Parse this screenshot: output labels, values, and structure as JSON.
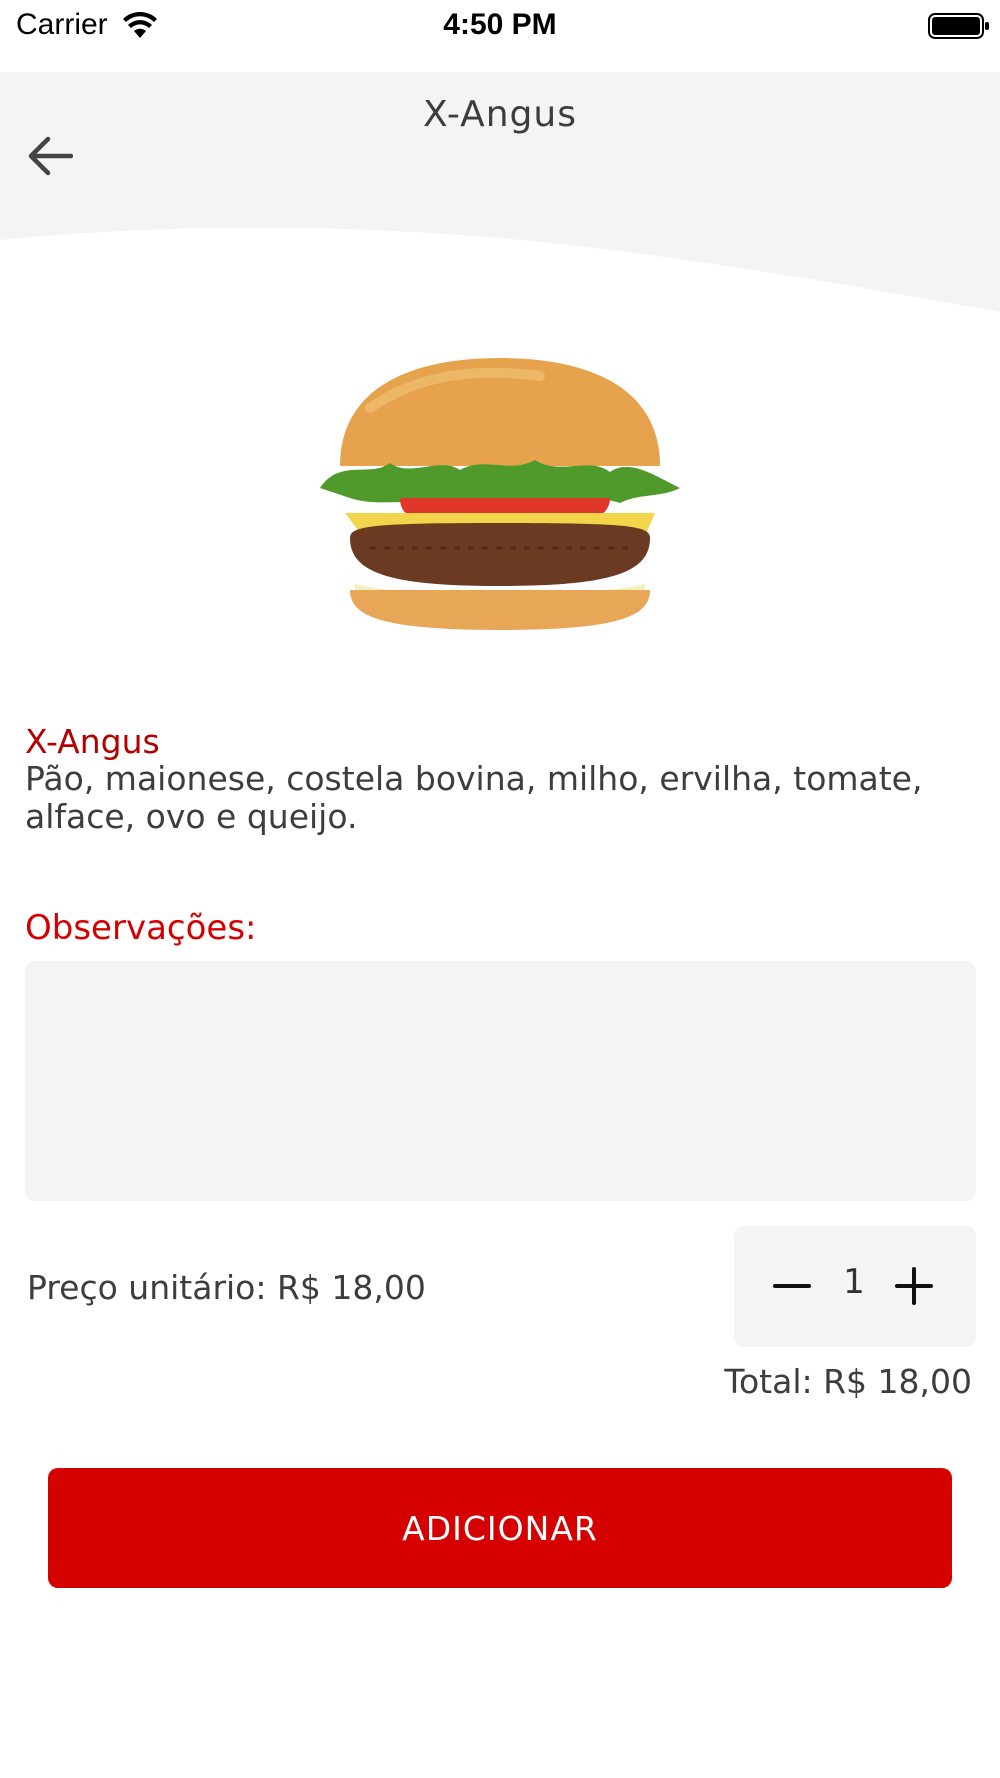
{
  "status_bar": {
    "carrier": "Carrier",
    "time": "4:50 PM",
    "icons": [
      "wifi-icon",
      "battery-icon"
    ]
  },
  "header": {
    "title": "X-Angus",
    "back_icon": "arrow-left-icon"
  },
  "product": {
    "name": "X-Angus",
    "description": "Pão, maionese, costela bovina, milho, ervilha, tomate, alface, ovo e queijo.",
    "image": "hamburger-photo"
  },
  "observations": {
    "label": "Observações:",
    "value": "",
    "placeholder": ""
  },
  "pricing": {
    "unit_price": "Preço unitário: R$ 18,00",
    "quantity": "1",
    "total": "Total: R$ 18,00"
  },
  "actions": {
    "add_label": "ADICIONAR"
  },
  "colors": {
    "accent": "#d50000",
    "name_red": "#b30000",
    "field_bg": "#f4f4f4",
    "text": "#3d3d3d"
  }
}
